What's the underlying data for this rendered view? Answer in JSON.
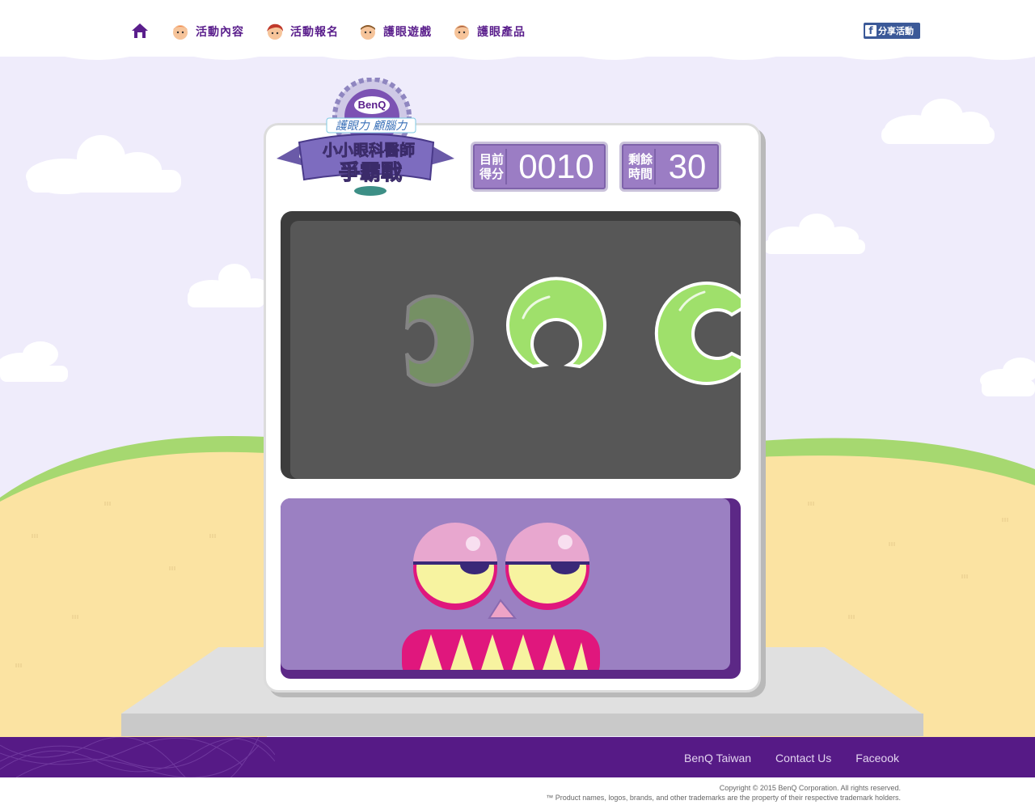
{
  "nav": {
    "home_icon": "house-icon",
    "items": [
      {
        "label": "活動內容",
        "face_color": "#f07b3f"
      },
      {
        "label": "活動報名",
        "face_color": "#c0392b"
      },
      {
        "label": "護眼遊戲",
        "face_color": "#e8a15a"
      },
      {
        "label": "護眼產品",
        "face_color": "#d98c4b"
      }
    ],
    "share_label": "分享活動",
    "share_icon": "facebook-icon"
  },
  "logo": {
    "brand": "BenQ",
    "slogan": "護眼力 顧腦力",
    "title_line1": "小小眼科醫師",
    "title_line2": "爭霸戰"
  },
  "score": {
    "label_line1": "目前",
    "label_line2": "得分",
    "value": "0010"
  },
  "timer": {
    "label_line1": "剩餘",
    "label_line2": "時間",
    "value": "30"
  },
  "game": {
    "rings": [
      {
        "opening": "left",
        "state": "faded"
      },
      {
        "opening": "bottom",
        "state": "active"
      },
      {
        "opening": "right",
        "state": "active"
      }
    ]
  },
  "footer": {
    "links": [
      "BenQ Taiwan",
      "Contact Us",
      "Faceook"
    ],
    "copyright_line1": "Copyright © 2015 BenQ Corporation. All rights reserved.",
    "copyright_line2": "™ Product names, logos, brands, and other trademarks are the property of their respective trademark holders."
  },
  "colors": {
    "accent_purple": "#5a1e8c",
    "panel_purple": "#9b7dc4",
    "ring_green": "#9fe06b",
    "sky": "#efecfb",
    "grass": "#a6d870",
    "sand": "#fbe3a2"
  }
}
